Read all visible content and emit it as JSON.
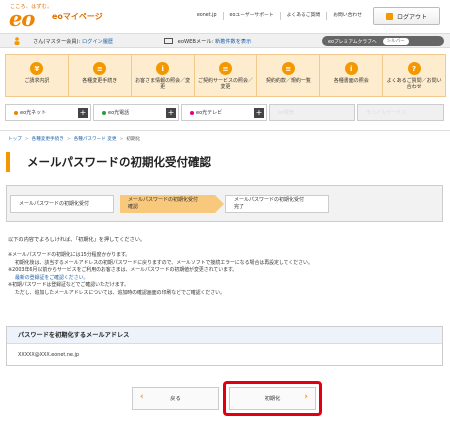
{
  "header": {
    "slogan": "こころ、はずむ。",
    "logo": "eo",
    "site_name": "eoマイページ",
    "links": [
      "eonet.jp",
      "eoユーザーサポート",
      "よくあるご質問",
      "お問い合わせ"
    ],
    "login_label": "ログアウト"
  },
  "member_bar": {
    "greeting": "さん(マスター会員):",
    "login_history": "ログイン履歴",
    "webmail_label": "eoWEBメール:",
    "webmail_link": "新着件数を表示",
    "premium_label": "eoプレミアムクラブへ",
    "rank": "シルバー"
  },
  "menu": {
    "items": [
      {
        "icon": "¥",
        "label": "ご請求内訳"
      },
      {
        "icon": "≡",
        "label": "各種変更手続き"
      },
      {
        "icon": "i",
        "label": "お客さま情報の照会／変更"
      },
      {
        "icon": "≡",
        "label": "ご契約サービスの照会／変更"
      },
      {
        "icon": "≡",
        "label": "契約約款／規約一覧"
      },
      {
        "icon": "i",
        "label": "各種書面の照会"
      },
      {
        "icon": "?",
        "label": "よくあるご質問／お問い合わせ"
      }
    ]
  },
  "services": {
    "tabs": [
      {
        "label": "eo光ネット",
        "enabled": true
      },
      {
        "label": "eo光電話",
        "enabled": true
      },
      {
        "label": "eo光テレビ",
        "enabled": true
      },
      {
        "label": "eo電気",
        "enabled": false
      },
      {
        "label": "モバイルサービス",
        "enabled": false
      }
    ]
  },
  "breadcrumb": {
    "items": [
      "トップ",
      "各種変更手続き",
      "各種パスワード 変更",
      "初期化"
    ]
  },
  "page": {
    "title": "メールパスワードの初期化受付確認"
  },
  "steps": {
    "step1": "メールパスワードの初期化受付",
    "step2_line1": "メールパスワードの初期化受付",
    "step2_line2": "確認",
    "step3_line1": "メールパスワードの初期化受付",
    "step3_line2": "完了"
  },
  "content": {
    "intro": "以下の内容でよろしければ、「初期化」を押してください。",
    "notes": [
      "※メールパスワードの初期化には15分程度かかります。",
      "初期化後は、該当するメールアドレスの初期パスワードに戻りますので、メールソフトで接続エラーになる場合は再設定してください。",
      "※2003年6月以前からサービスをご利用のお客さまは、メールパスワードの初期値が変更されています。",
      "最新の登録証をご確認ください。",
      "※初期パスワードは登録証などでご確認いただけます。",
      "ただし、追加したメールアドレスについては、追加時の確認画面の印刷などでご確認ください。"
    ]
  },
  "mail_box": {
    "heading": "パスワードを初期化するメールアドレス",
    "address": "XXXXX@XXX.eonet.ne.jp"
  },
  "buttons": {
    "back_label": "戻る",
    "next_label": "初期化"
  }
}
